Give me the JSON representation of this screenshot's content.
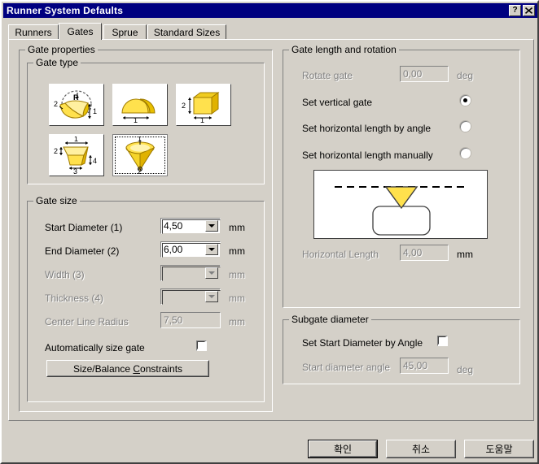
{
  "window": {
    "title": "Runner System Defaults",
    "help_button": "?",
    "close_button": "✕"
  },
  "tabs": [
    {
      "label": "Runners",
      "active": false
    },
    {
      "label": "Gates",
      "active": true
    },
    {
      "label": "Sprue",
      "active": false
    },
    {
      "label": "Standard Sizes",
      "active": false
    }
  ],
  "gate_properties": {
    "legend": "Gate properties",
    "gate_type": {
      "legend": "Gate type",
      "options": [
        {
          "name": "curved-banana-gate",
          "selected": false,
          "dims": [
            "R",
            "2",
            "1"
          ]
        },
        {
          "name": "half-round-gate",
          "selected": false,
          "dims": [
            "1"
          ]
        },
        {
          "name": "rectangular-gate",
          "selected": false,
          "dims": [
            "2",
            "1"
          ]
        },
        {
          "name": "trapezoid-gate",
          "selected": false,
          "dims": [
            "1",
            "2",
            "4",
            "3"
          ]
        },
        {
          "name": "cone-subgate",
          "selected": true,
          "dims": [
            "1",
            "2"
          ]
        }
      ]
    },
    "gate_size": {
      "legend": "Gate size",
      "rows": [
        {
          "label": "Start Diameter (1)",
          "value": "4,50",
          "unit": "mm",
          "type": "combo",
          "enabled": true
        },
        {
          "label": "End Diameter (2)",
          "value": "6,00",
          "unit": "mm",
          "type": "combo",
          "enabled": true
        },
        {
          "label": "Width (3)",
          "value": "",
          "unit": "mm",
          "type": "combo",
          "enabled": false
        },
        {
          "label": "Thickness (4)",
          "value": "",
          "unit": "mm",
          "type": "combo",
          "enabled": false
        },
        {
          "label": "Center Line Radius",
          "value": "7,50",
          "unit": "mm",
          "type": "text",
          "enabled": false
        }
      ],
      "auto_size": {
        "label": "Automatically size gate",
        "checked": false
      },
      "constraints_button": {
        "pre": "Size/Balance ",
        "accel": "C",
        "post": "onstraints"
      }
    }
  },
  "gate_length_rotation": {
    "legend": "Gate length and rotation",
    "rotate_gate": {
      "label": "Rotate gate",
      "value": "0,00",
      "unit": "deg",
      "enabled": false
    },
    "radios": [
      {
        "label": "Set vertical gate",
        "selected": true
      },
      {
        "label": "Set horizontal length by angle",
        "selected": false
      },
      {
        "label": "Set horizontal length manually",
        "selected": false
      }
    ],
    "horizontal_length": {
      "label": "Horizontal Length",
      "value": "4,00",
      "unit": "mm",
      "enabled": false
    }
  },
  "subgate_diameter": {
    "legend": "Subgate diameter",
    "set_by_angle": {
      "label": "Set Start Diameter by Angle",
      "checked": false
    },
    "start_angle": {
      "label": "Start diameter angle",
      "value": "45,00",
      "unit": "deg",
      "enabled": false
    }
  },
  "footer": {
    "ok": "확인",
    "cancel": "취소",
    "help": "도움말"
  },
  "colors": {
    "titlebar": "#000080",
    "dialog_face": "#d4d0c8",
    "gate_yellow": "#ffe14d",
    "gate_yellow_dark": "#e0b200",
    "disabled_text": "#808080"
  }
}
